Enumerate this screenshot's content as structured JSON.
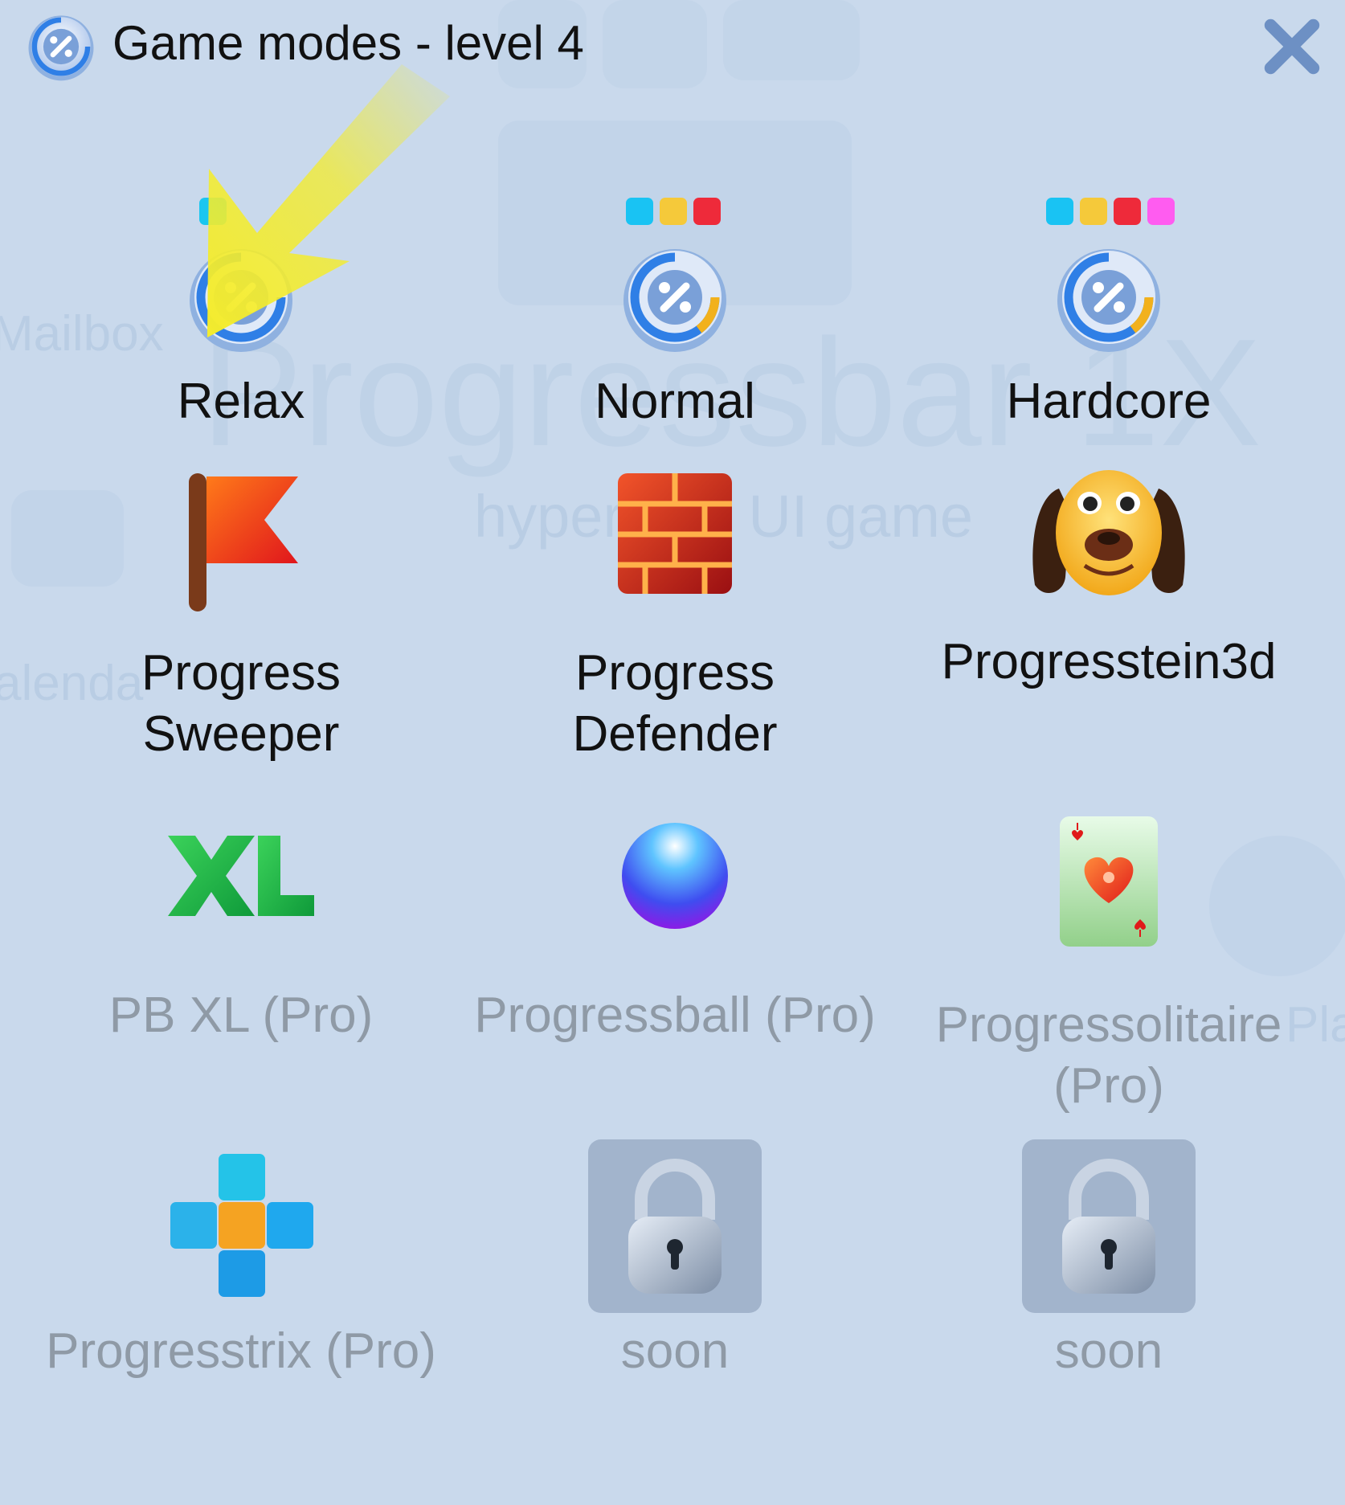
{
  "window": {
    "title": "Game modes - level 4",
    "app_icon": "progressbar-logo-icon",
    "close_icon": "close-x-icon"
  },
  "background": {
    "word_brand": "Progressbar 1X",
    "word_tagline": "hyper... al UI game",
    "word_mailbox": "Mailbox",
    "word_calendar": "alenda",
    "word_right": "Pla"
  },
  "modes": [
    {
      "id": "relax",
      "label": "Relax",
      "icon": "progressbar-gauge-icon",
      "difficulty_colors": [
        "#1ac6f0"
      ],
      "locked": false
    },
    {
      "id": "normal",
      "label": "Normal",
      "icon": "progressbar-gauge-icon",
      "difficulty_colors": [
        "#19c3f3",
        "#f5c93a",
        "#ee2a3a"
      ],
      "locked": false
    },
    {
      "id": "hardcore",
      "label": "Hardcore",
      "icon": "progressbar-gauge-icon",
      "difficulty_colors": [
        "#19c3f3",
        "#f5c93a",
        "#ee2a3a",
        "#ff5cf0"
      ],
      "locked": false
    },
    {
      "id": "sweeper",
      "label_line1": "Progress",
      "label_line2": "Sweeper",
      "icon": "red-flag-icon",
      "locked": false
    },
    {
      "id": "defender",
      "label_line1": "Progress",
      "label_line2": "Defender",
      "icon": "brick-wall-icon",
      "locked": false
    },
    {
      "id": "stein",
      "label": "Progresstein3d",
      "icon": "dog-face-icon",
      "locked": false
    },
    {
      "id": "pbxl",
      "label": "PB XL (Pro)",
      "icon": "xl-text-icon",
      "locked": false
    },
    {
      "id": "ball",
      "label": "Progressball (Pro)",
      "icon": "blue-ball-icon",
      "locked": false
    },
    {
      "id": "solitaire",
      "label_line1": "Progressolitaire",
      "label_line2": "(Pro)",
      "icon": "heart-card-icon",
      "locked": false
    },
    {
      "id": "strix",
      "label": "Progresstrix (Pro)",
      "icon": "plus-blocks-icon",
      "locked": false
    },
    {
      "id": "soon1",
      "label": "soon",
      "icon": "padlock-icon",
      "locked": true
    },
    {
      "id": "soon2",
      "label": "soon",
      "icon": "padlock-icon",
      "locked": true
    }
  ],
  "colors": {
    "background": "#c9d9ec",
    "pro_text": "#8f9aa6",
    "highlight_arrow": "#f4ec2c"
  }
}
